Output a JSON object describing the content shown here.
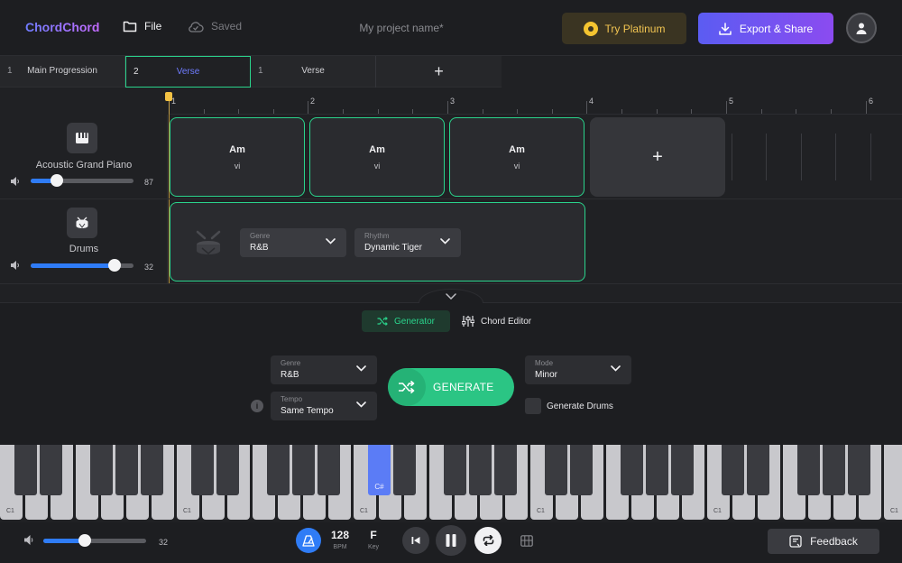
{
  "app": {
    "logo": "ChordChord",
    "file_label": "File",
    "saved_label": "Saved",
    "project_name": "My project name*",
    "platinum_label": "Try Platinum",
    "export_label": "Export & Share",
    "colors": {
      "accent_green": "#2ad48c",
      "accent_blue": "#2f7cf6",
      "brand_purple": "#6f7cff",
      "gold": "#f3c244"
    }
  },
  "tabs": [
    {
      "num": "1",
      "label": "Main Progression"
    },
    {
      "num": "2",
      "label": "Verse",
      "active": true
    },
    {
      "num": "1",
      "label": "Verse"
    },
    {
      "label": "+"
    }
  ],
  "ruler": {
    "labels": [
      "1",
      "2",
      "3",
      "4",
      "5",
      "6"
    ]
  },
  "tracks": [
    {
      "name": "Acoustic Grand Piano",
      "icon": "piano-icon",
      "volume": 87,
      "volume_pct": 0.25
    },
    {
      "name": "Drums",
      "icon": "drum-icon",
      "volume": 32,
      "volume_pct": 0.82
    }
  ],
  "chords": [
    {
      "name": "Am",
      "degree": "vi"
    },
    {
      "name": "Am",
      "degree": "vi"
    },
    {
      "name": "Am",
      "degree": "vi"
    }
  ],
  "chord_add_label": "+",
  "drum_block": {
    "genre": {
      "label": "Genre",
      "value": "R&B"
    },
    "rhythm": {
      "label": "Rhythm",
      "value": "Dynamic Tiger"
    }
  },
  "panel": {
    "tabs": {
      "generator": "Generator",
      "chord_editor": "Chord Editor"
    },
    "genre": {
      "label": "Genre",
      "value": "R&B"
    },
    "tempo": {
      "label": "Tempo",
      "value": "Same Tempo"
    },
    "mode": {
      "label": "Mode",
      "value": "Minor"
    },
    "generate_label": "GENERATE",
    "generate_drums_label": "Generate Drums",
    "info_icon": "i"
  },
  "keyboard": {
    "octave_label": "C1",
    "highlighted_key_label": "C#"
  },
  "bottom": {
    "volume": 32,
    "volume_pct": 0.4,
    "bpm_value": "128",
    "bpm_unit": "BPM",
    "key_value": "F",
    "key_unit": "Key",
    "feedback_label": "Feedback"
  }
}
